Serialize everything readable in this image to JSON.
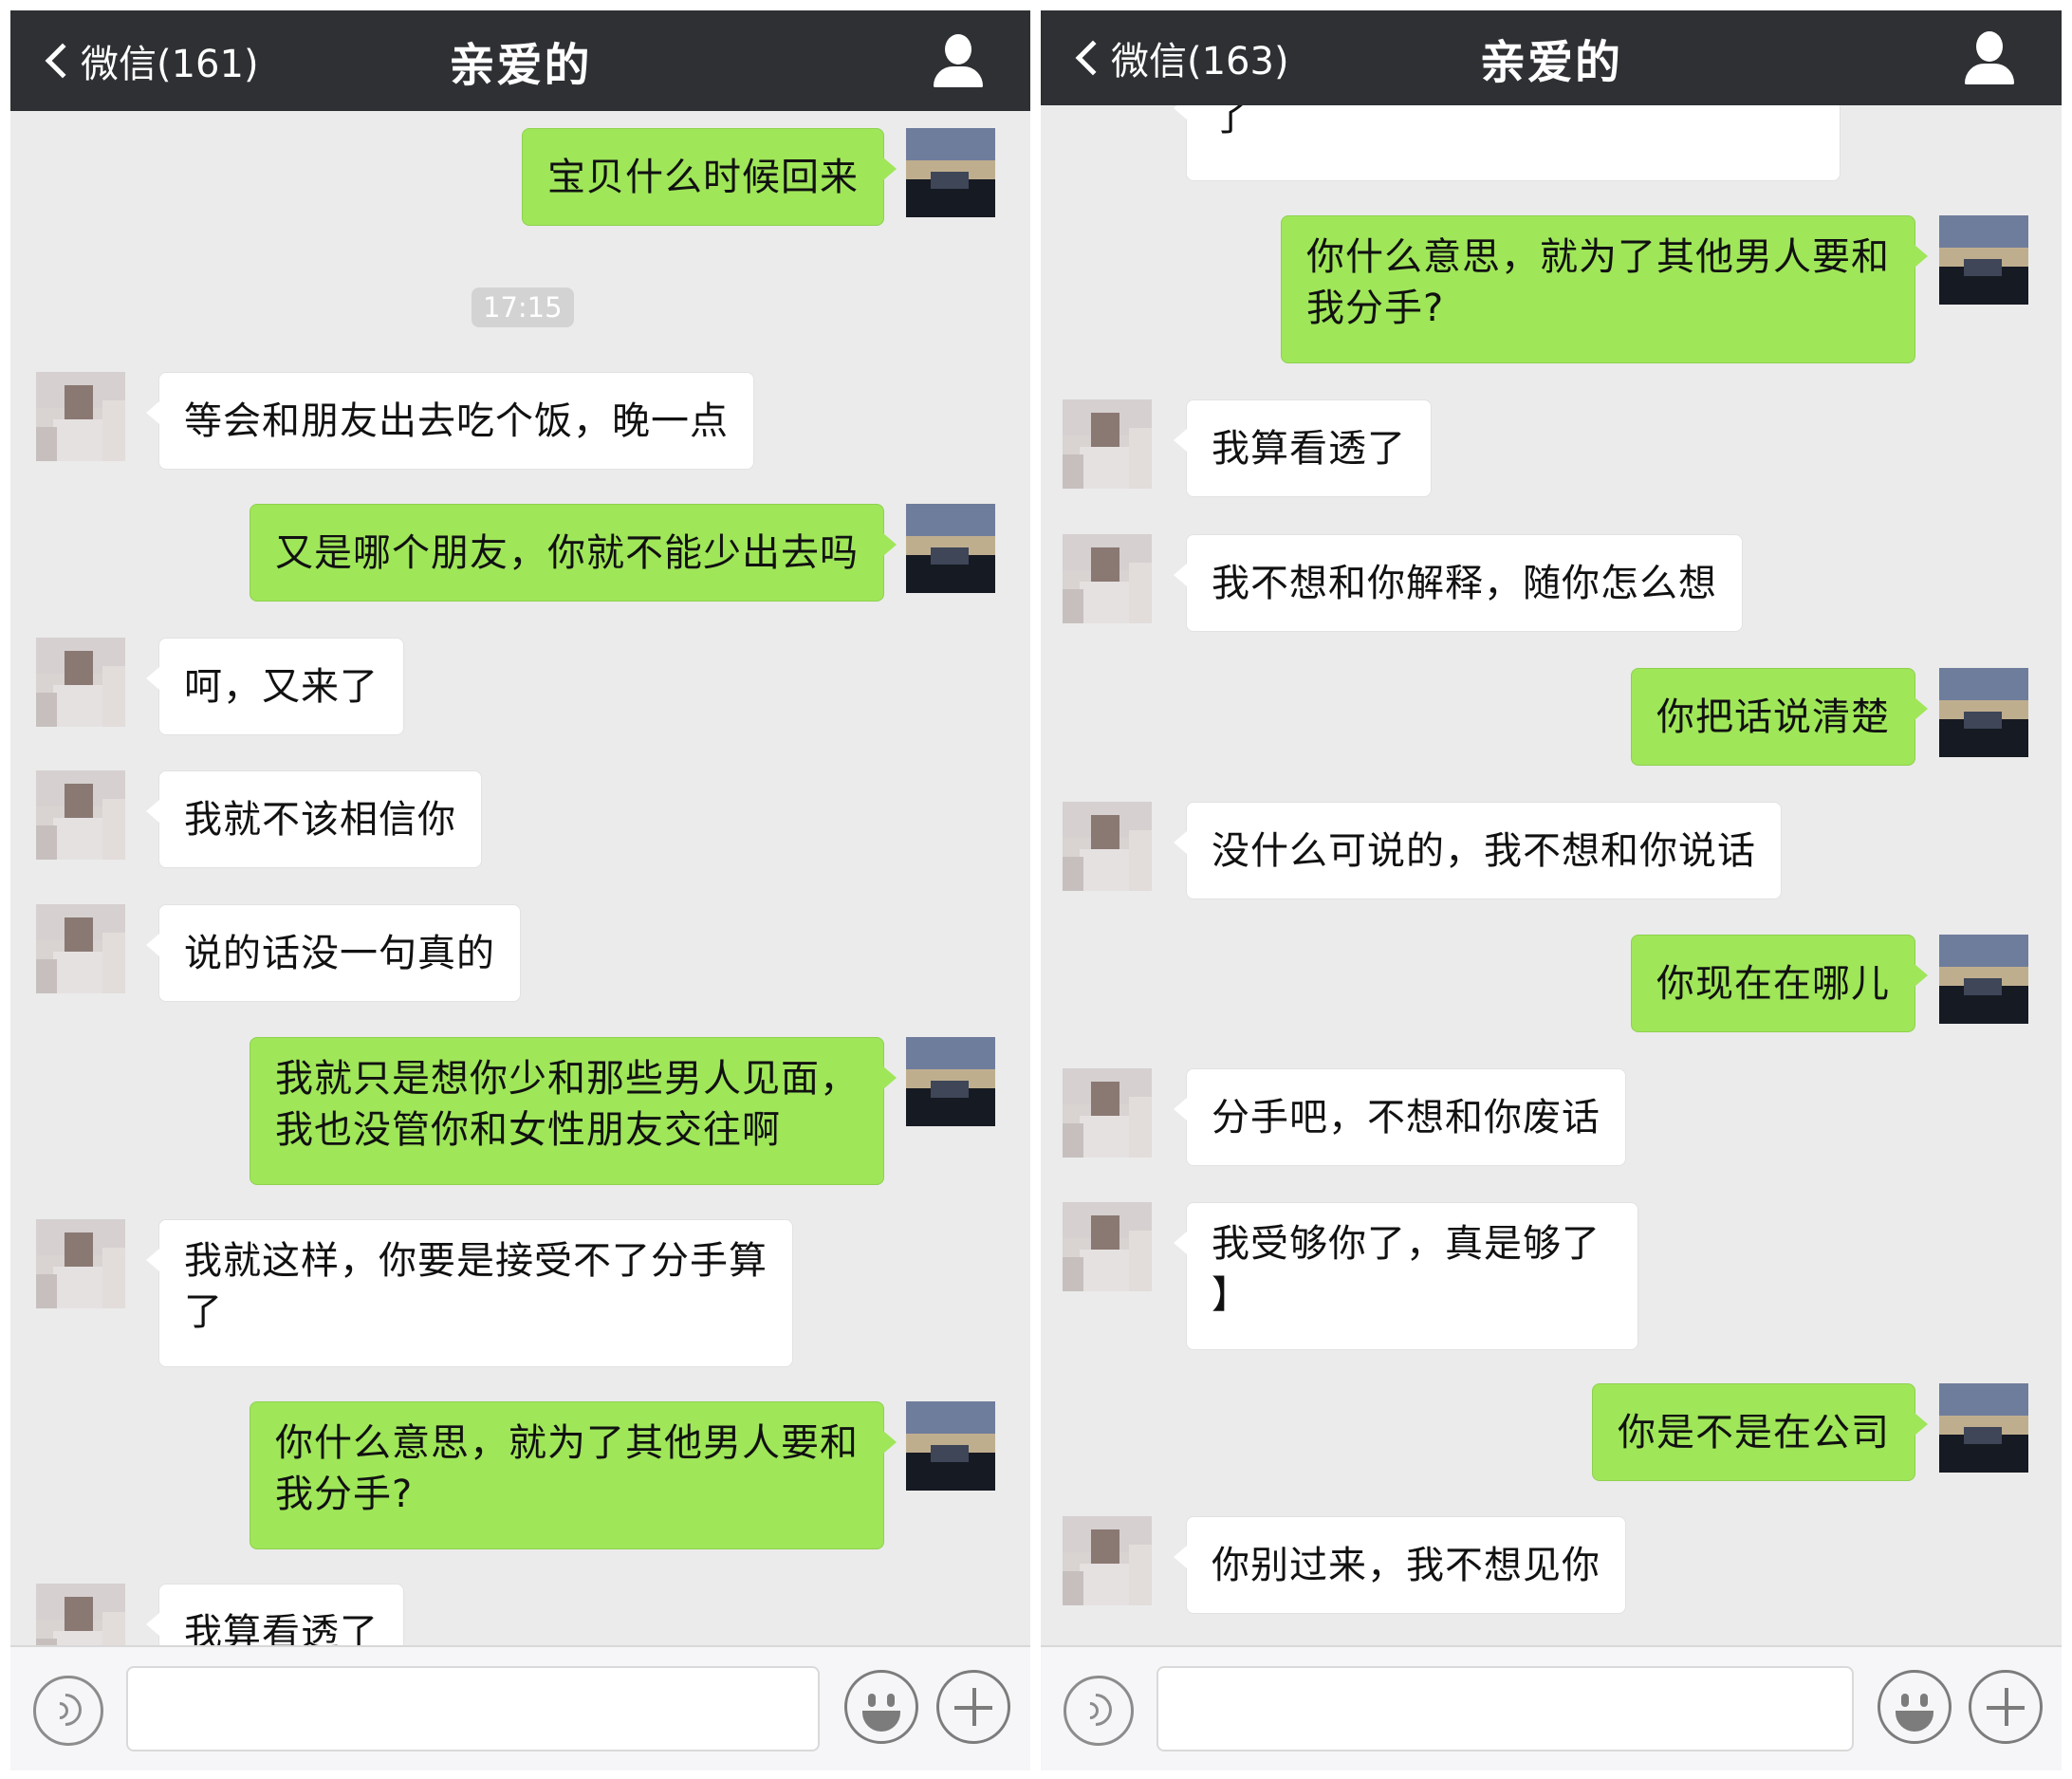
{
  "left": {
    "header": {
      "back_label": "微信(161)",
      "title": "亲爱的"
    },
    "timestamp": "17:15",
    "messages": [
      {
        "text": "宝贝什么时候回来"
      },
      {
        "text": "等会和朋友出去吃个饭，晚一点"
      },
      {
        "text": "又是哪个朋友，你就不能少出去吗"
      },
      {
        "text": "呵，又来了"
      },
      {
        "text": "我就不该相信你"
      },
      {
        "text": "说的话没一句真的"
      },
      {
        "text": "我就只是想你少和那些男人见面，\n我也没管你和女性朋友交往啊"
      },
      {
        "text": "我就这样，你要是接受不了分手算\n了"
      },
      {
        "text": "你什么意思，就为了其他男人要和\n我分手?"
      },
      {
        "text": "我算看透了"
      }
    ]
  },
  "right": {
    "header": {
      "back_label": "微信(163)",
      "title": "亲爱的"
    },
    "messages": [
      {
        "text": "了"
      },
      {
        "text": "你什么意思，就为了其他男人要和\n我分手?"
      },
      {
        "text": "我算看透了"
      },
      {
        "text": "我不想和你解释，随你怎么想"
      },
      {
        "text": "你把话说清楚"
      },
      {
        "text": "没什么可说的，我不想和你说话"
      },
      {
        "text": "你现在在哪儿"
      },
      {
        "text": "分手吧，不想和你废话"
      },
      {
        "text": "我受够你了，真是够了\n】"
      },
      {
        "text": "你是不是在公司"
      },
      {
        "text": "你别过来，我不想见你"
      }
    ]
  },
  "colors": {
    "navbar": "#2e3033",
    "chat_background": "#ebebeb",
    "outgoing_bubble": "#9fe659",
    "incoming_bubble": "#ffffff",
    "toolbar": "#f6f6f8"
  },
  "icons": {
    "back": "chevron-left-icon",
    "contact": "person-icon",
    "voice": "voice-icon",
    "emoji": "emoji-icon",
    "more": "plus-icon"
  }
}
